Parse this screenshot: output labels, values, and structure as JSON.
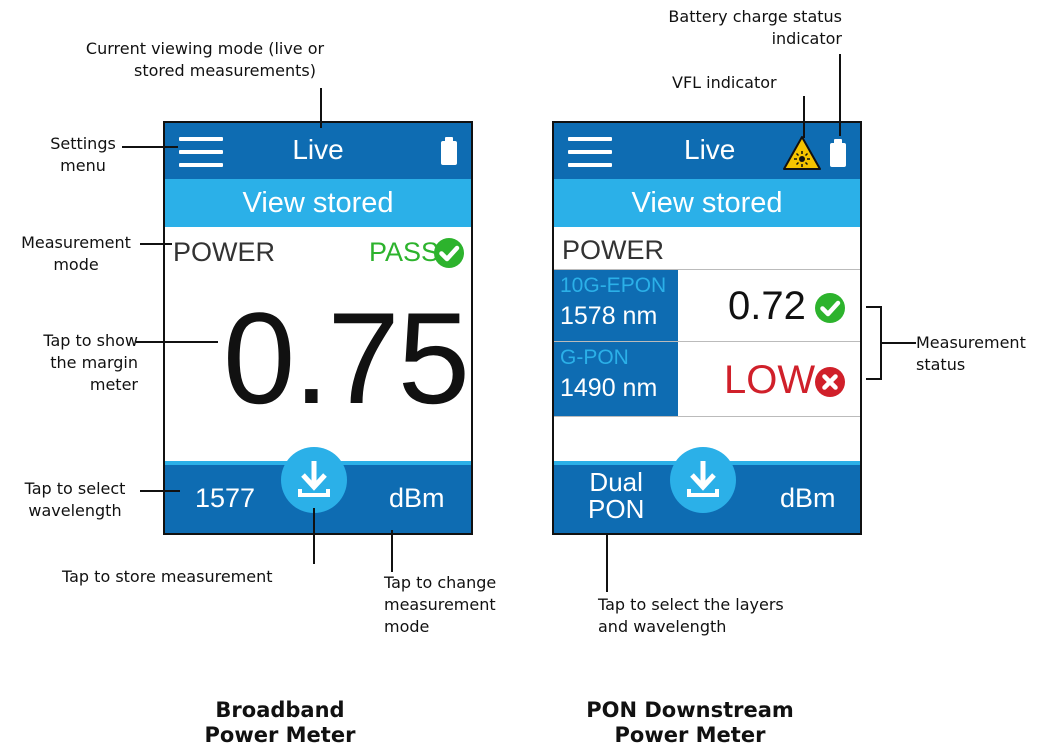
{
  "annotations": {
    "viewing_mode": [
      "Current viewing mode (live or",
      "stored measurements)"
    ],
    "settings_menu": [
      "Settings",
      "menu"
    ],
    "measurement_mode": [
      "Measurement",
      "mode"
    ],
    "margin_meter": [
      "Tap to show",
      "the margin",
      "meter"
    ],
    "select_wavelength": [
      "Tap to select",
      "wavelength"
    ],
    "store_measurement": "Tap to store measurement",
    "change_mode": [
      "Tap to change",
      "measurement",
      "mode"
    ],
    "battery": [
      "Battery charge status",
      "indicator"
    ],
    "vfl": "VFL indicator",
    "measurement_status": [
      "Measurement",
      "status"
    ],
    "select_layers": [
      "Tap to select the layers",
      "and wavelength"
    ]
  },
  "captions": {
    "broadband": [
      "Broadband",
      "Power Meter"
    ],
    "pon": [
      "PON Downstream",
      "Power Meter"
    ]
  },
  "broadband": {
    "header_title": "Live",
    "view_button": "View stored",
    "mode_label": "POWER",
    "status_label": "PASS",
    "value": "0.75",
    "wavelength": "1577",
    "unit": "dBm"
  },
  "pon": {
    "header_title": "Live",
    "view_button": "View stored",
    "mode_label": "POWER",
    "rows": [
      {
        "layer": "10G-EPON",
        "wavelength": "1578 nm",
        "value": "0.72",
        "status": "pass"
      },
      {
        "layer": "G-PON",
        "wavelength": "1490 nm",
        "value": "LOW",
        "status": "fail"
      }
    ],
    "footer_mode": [
      "Dual",
      "PON"
    ],
    "unit": "dBm"
  },
  "colors": {
    "header_blue": "#0e6cb2",
    "accent_cyan": "#2bb0e8",
    "pass_green": "#2db32d",
    "fail_red": "#d0202a",
    "vfl_yellow": "#f5c400"
  },
  "icons": {
    "menu": "hamburger-menu-icon",
    "battery": "battery-icon",
    "vfl": "vfl-laser-warning-icon",
    "store": "download-store-icon",
    "pass": "checkmark-circle-icon",
    "fail": "x-circle-icon"
  }
}
